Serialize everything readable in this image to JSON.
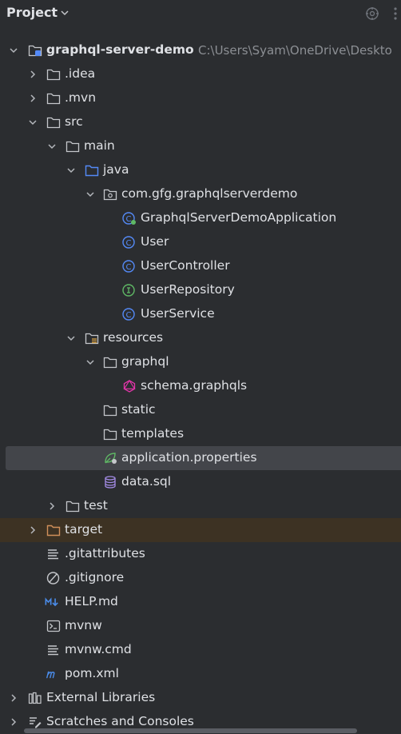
{
  "header": {
    "title": "Project",
    "chevron_icon": "chevron-down-icon",
    "actions": [
      "locate-icon",
      "more-icon"
    ]
  },
  "tree": {
    "root": {
      "label": "graphql-server-demo",
      "path": "C:\\Users\\Syam\\OneDrive\\Deskto"
    },
    "nodes": {
      "idea": ".idea",
      "mvn": ".mvn",
      "src": "src",
      "main": "main",
      "java": "java",
      "package": "com.gfg.graphqlserverdemo",
      "app_class": "GraphqlServerDemoApplication",
      "user": "User",
      "user_controller": "UserController",
      "user_repository": "UserRepository",
      "user_service": "UserService",
      "resources": "resources",
      "graphql": "graphql",
      "schema": "schema.graphqls",
      "static": "static",
      "templates": "templates",
      "app_props": "application.properties",
      "data_sql": "data.sql",
      "test": "test",
      "target": "target",
      "gitattributes": ".gitattributes",
      "gitignore": ".gitignore",
      "help_md": "HELP.md",
      "mvnw": "mvnw",
      "mvnw_cmd": "mvnw.cmd",
      "pom": "pom.xml",
      "external_libraries": "External Libraries",
      "scratches": "Scratches and Consoles"
    }
  },
  "colors": {
    "background": "#2b2d30",
    "text": "#dfe1e5",
    "muted": "#8c8f94",
    "selection": "#43454a",
    "excluded_row": "#3d3223",
    "source_folder": "#548af7",
    "class_icon": "#548af7",
    "interface_icon": "#5fb865",
    "graphql_pink": "#e535ab",
    "excluded_folder": "#d08f5a",
    "markdown": "#4a8be8",
    "database": "#a48ce6"
  }
}
